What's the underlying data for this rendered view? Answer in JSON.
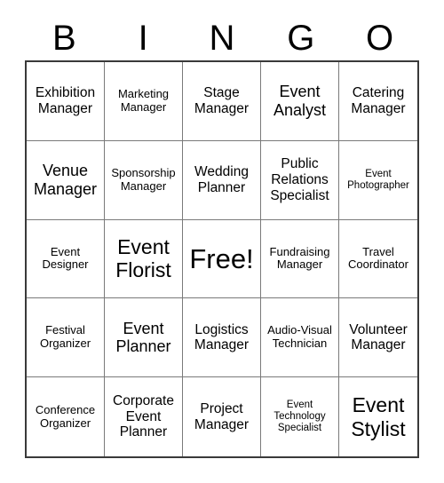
{
  "header": {
    "letters": [
      "B",
      "I",
      "N",
      "G",
      "O"
    ]
  },
  "grid": {
    "rows": 5,
    "columns": 5,
    "border_color": "#3a3a3a",
    "inner_line_color": "#7a7a7a",
    "background_color": "#ffffff",
    "text_color": "#000000",
    "cells": [
      {
        "label": "Exhibition Manager",
        "size": "md",
        "free": false
      },
      {
        "label": "Marketing Manager",
        "size": "sm",
        "free": false
      },
      {
        "label": "Stage Manager",
        "size": "md",
        "free": false
      },
      {
        "label": "Event Analyst",
        "size": "lg",
        "free": false
      },
      {
        "label": "Catering Manager",
        "size": "md",
        "free": false
      },
      {
        "label": "Venue Manager",
        "size": "lg",
        "free": false
      },
      {
        "label": "Sponsorship Manager",
        "size": "sm",
        "free": false
      },
      {
        "label": "Wedding Planner",
        "size": "md",
        "free": false
      },
      {
        "label": "Public Relations Specialist",
        "size": "md",
        "free": false
      },
      {
        "label": "Event Photographer",
        "size": "xs",
        "free": false
      },
      {
        "label": "Event Designer",
        "size": "sm",
        "free": false
      },
      {
        "label": "Event Florist",
        "size": "xl",
        "free": false
      },
      {
        "label": "Free!",
        "size": "xxl",
        "free": true
      },
      {
        "label": "Fundraising Manager",
        "size": "sm",
        "free": false
      },
      {
        "label": "Travel Coordinator",
        "size": "sm",
        "free": false
      },
      {
        "label": "Festival Organizer",
        "size": "sm",
        "free": false
      },
      {
        "label": "Event Planner",
        "size": "lg",
        "free": false
      },
      {
        "label": "Logistics Manager",
        "size": "md",
        "free": false
      },
      {
        "label": "Audio-Visual Technician",
        "size": "sm",
        "free": false
      },
      {
        "label": "Volunteer Manager",
        "size": "md",
        "free": false
      },
      {
        "label": "Conference Organizer",
        "size": "sm",
        "free": false
      },
      {
        "label": "Corporate Event Planner",
        "size": "md",
        "free": false
      },
      {
        "label": "Project Manager",
        "size": "md",
        "free": false
      },
      {
        "label": "Event Technology Specialist",
        "size": "xs",
        "free": false
      },
      {
        "label": "Event Stylist",
        "size": "xl",
        "free": false
      }
    ]
  }
}
